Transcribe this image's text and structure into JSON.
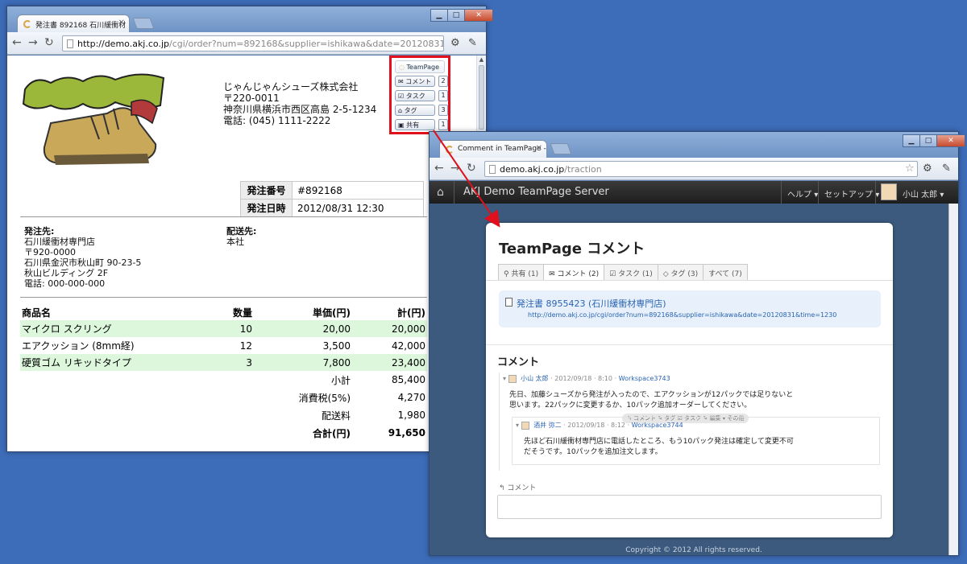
{
  "window1": {
    "tab_title": "発注書 892168 石川緩衝材",
    "url_host": "http://demo.akj.co.jp",
    "url_path": "/cgi/order?num=892168&supplier=ishikawa&date=20120831&time=1230",
    "company": {
      "name": "じゃんじゃんシューズ株式会社",
      "zip": "〒220-0011",
      "address": "神奈川県横浜市西区高島 2-5-1234",
      "phone": "電話: (045) 1111-2222"
    },
    "teampage_widget": {
      "title": "TeamPage",
      "buttons": [
        {
          "label": "コメント",
          "count": "2"
        },
        {
          "label": "タスク",
          "count": "1"
        },
        {
          "label": "タグ",
          "count": "3"
        },
        {
          "label": "共有",
          "count": "1"
        }
      ]
    },
    "meta": [
      {
        "key": "発注番号",
        "value": "#892168"
      },
      {
        "key": "発注日時",
        "value": "2012/08/31 12:30"
      }
    ],
    "ship_from": {
      "heading": "発注先:",
      "lines": [
        "石川緩衝材専門店",
        "〒920-0000",
        "石川県金沢市秋山町 90-23-5",
        "秋山ビルディング 2F",
        "電話: 000-000-000"
      ]
    },
    "ship_to": {
      "heading": "配送先:",
      "lines": [
        "本社"
      ]
    },
    "items_header": {
      "name": "商品名",
      "qty": "数量",
      "unit": "単価(円)",
      "total": "計(円)"
    },
    "items": [
      {
        "name": "マイクロ スクリング",
        "qty": "10",
        "unit": "20,00",
        "total": "20,000"
      },
      {
        "name": "エアクッション (8mm経)",
        "qty": "12",
        "unit": "3,500",
        "total": "42,000"
      },
      {
        "name": "硬質ゴム リキッドタイプ",
        "qty": "3",
        "unit": "7,800",
        "total": "23,400"
      }
    ],
    "summary": [
      {
        "label": "小計",
        "value": "85,400"
      },
      {
        "label": "消費税(5%)",
        "value": "4,270"
      },
      {
        "label": "配送料",
        "value": "1,980"
      },
      {
        "label": "合計(円)",
        "value": "91,650"
      }
    ]
  },
  "window2": {
    "tab_title": "Comment in TeamPage - A",
    "url_host": "demo.akj.co.jp",
    "url_path": "/traction",
    "nav": {
      "brand": "AKJ Demo TeamPage Server",
      "help": "ヘルプ",
      "setup": "セットアップ",
      "user": "小山 太郎"
    },
    "card_title": "TeamPage コメント",
    "tabs": [
      "共有 (1)",
      "コメント (2)",
      "タスク (1)",
      "タグ (3)",
      "すべて (7)"
    ],
    "doc": {
      "title": "発注書 8955423 (石川緩衝材専門店)",
      "url": "http://demo.akj.co.jp/cgi/order?num=892168&supplier=ishikawa&date=20120831&time=1230"
    },
    "comments_heading": "コメント",
    "comment1": {
      "author": "小山 太郎",
      "meta": "· 2012/09/18 · 8:10 ·",
      "space": "Workspace3743",
      "body": "先日、加藤シューズから発注が入ったので、エアクッションが12パックでは足りないと思います。22パックに変更するか、10パック追加オーダーしてください。"
    },
    "actions": "↰ コメント  ✎ タグ  ☑ タスク  ✎ 編集  ▾ その他",
    "comment2": {
      "author": "酒井 弥二",
      "meta": "· 2012/09/18 · 8:12 ·",
      "space": "Workspace3744",
      "body": "先ほど石川緩衝材専門店に電話したところ、もう10パック発注は確定して変更不可だそうです。10パックを追加注文します。"
    },
    "reply_label": "コメント",
    "copyright": "Copyright © 2012 All rights reserved."
  },
  "colors": {
    "desktop": "#3d6cb8",
    "highlight_border": "#e0101c",
    "row_highlight": "#ddf7dd",
    "link": "#2a64b2"
  }
}
